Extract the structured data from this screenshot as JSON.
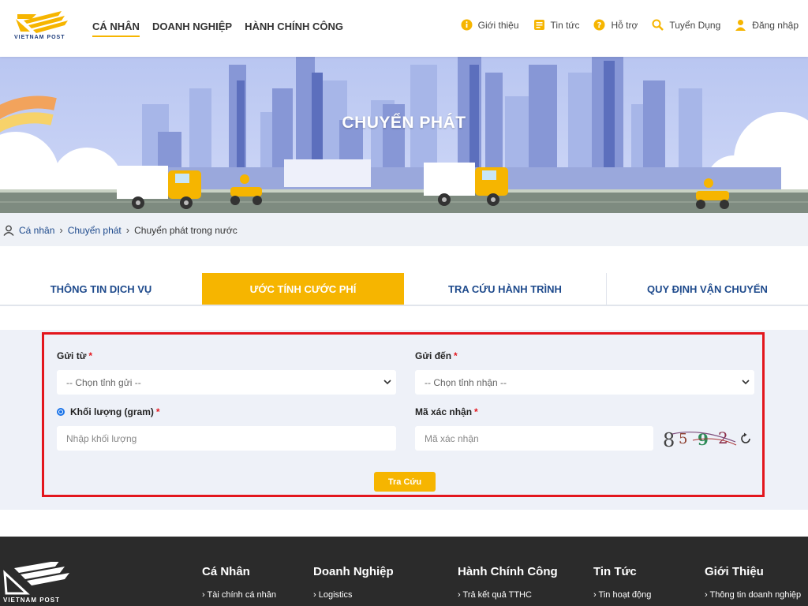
{
  "header": {
    "logo_text": "VIETNAM POST",
    "main_nav": [
      {
        "label": "CÁ NHÂN",
        "active": true
      },
      {
        "label": "DOANH NGHIỆP",
        "active": false
      },
      {
        "label": "HÀNH CHÍNH CÔNG",
        "active": false
      }
    ],
    "top_nav": [
      {
        "label": "Giới thiệu",
        "icon": "info-icon"
      },
      {
        "label": "Tin tức",
        "icon": "news-icon"
      },
      {
        "label": "Hỗ trợ",
        "icon": "help-icon"
      },
      {
        "label": "Tuyển Dụng",
        "icon": "search-icon"
      },
      {
        "label": "Đăng nhập",
        "icon": "user-icon"
      }
    ]
  },
  "banner": {
    "title": "CHUYỂN PHÁT"
  },
  "breadcrumb": {
    "items": [
      "Cá nhân",
      "Chuyển phát",
      "Chuyển phát trong nước"
    ]
  },
  "tabs": [
    {
      "label": "THÔNG TIN DỊCH VỤ",
      "active": false
    },
    {
      "label": "ƯỚC TÍNH CƯỚC PHÍ",
      "active": true
    },
    {
      "label": "TRA CỨU HÀNH TRÌNH",
      "active": false
    },
    {
      "label": "QUY ĐỊNH VẬN CHUYỂN",
      "active": false
    }
  ],
  "form": {
    "from_label": "Gửi từ",
    "from_value": "-- Chọn tỉnh gửi --",
    "to_label": "Gửi đến",
    "to_value": "-- Chọn tỉnh nhận --",
    "weight_label": "Khối lượng (gram)",
    "weight_placeholder": "Nhập khối lượng",
    "captcha_label": "Mã xác nhận",
    "captcha_placeholder": "Mã xác nhận",
    "captcha_text": "8592",
    "required_mark": "*",
    "submit_label": "Tra Cứu"
  },
  "footer": {
    "logo_text": "VIETNAM POST",
    "columns": [
      {
        "heading": "Cá Nhân",
        "first_link": "Tài chính cá nhân"
      },
      {
        "heading": "Doanh Nghiệp",
        "first_link": "Logistics"
      },
      {
        "heading": "Hành Chính Công",
        "first_link": "Trả kết quả TTHC"
      },
      {
        "heading": "Tin Tức",
        "first_link": "Tin hoạt động"
      },
      {
        "heading": "Giới Thiệu",
        "first_link": "Thông tin doanh nghiệp"
      }
    ]
  },
  "colors": {
    "accent": "#f6b500",
    "primary_text": "#1e4a8c",
    "highlight_border": "#e3161d",
    "footer_bg": "#2b2b2b"
  }
}
